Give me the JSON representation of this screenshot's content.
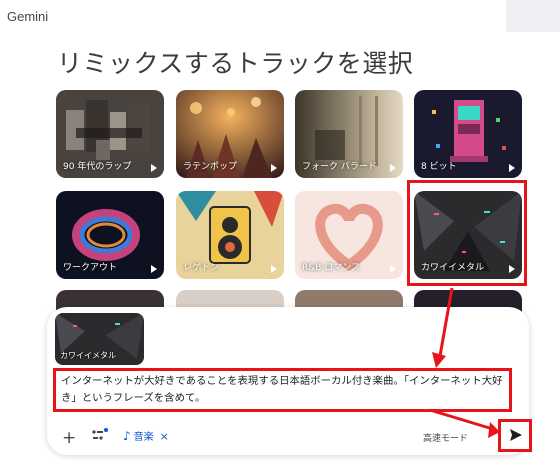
{
  "app": {
    "brand": "Gemini"
  },
  "page": {
    "heading": "リミックスするトラックを選択"
  },
  "tracks": [
    {
      "label": "90 年代のラップ"
    },
    {
      "label": "ラテンポップ"
    },
    {
      "label": "フォーク バラード"
    },
    {
      "label": "8 ビット"
    },
    {
      "label": "ワークアウト"
    },
    {
      "label": "レゲトン"
    },
    {
      "label": "R&B ロマンス"
    },
    {
      "label": "カワイイメタル"
    }
  ],
  "composer": {
    "selected_track": "カワイイメタル",
    "prompt": "インターネットが大好きであることを表現する日本語ボーカル付き楽曲。「インターネット大好き」というフレーズを含めて。",
    "music_chip": "音楽",
    "mode": "高速モード"
  },
  "colors": {
    "highlight": "#e8141b",
    "accent": "#0b57d0"
  }
}
